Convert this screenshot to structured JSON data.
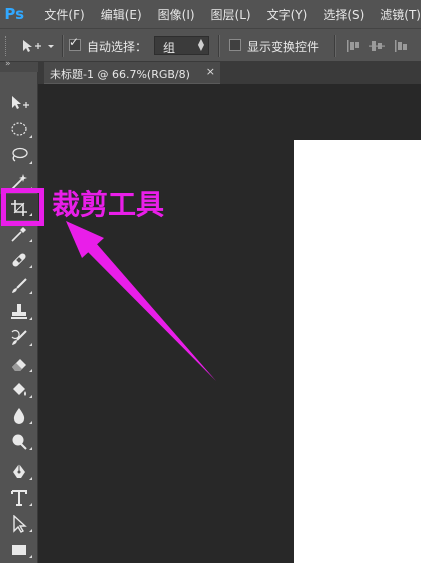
{
  "app": {
    "logo_text": "Ps"
  },
  "menu": {
    "items": [
      "文件(F)",
      "编辑(E)",
      "图像(I)",
      "图层(L)",
      "文字(Y)",
      "选择(S)",
      "滤镜(T)"
    ]
  },
  "options_bar": {
    "auto_select_label": "自动选择：",
    "auto_select_checked": true,
    "auto_select_target": "组",
    "show_transform_label": "显示变换控件",
    "show_transform_checked": false
  },
  "document": {
    "tab_title": "未标题-1 @ 66.7%(RGB/8)",
    "close_glyph": "×"
  },
  "tools": [
    {
      "name": "move-tool",
      "icon": "move-icon"
    },
    {
      "name": "marquee-tool",
      "icon": "ellipse-marquee-icon"
    },
    {
      "name": "lasso-tool",
      "icon": "lasso-icon"
    },
    {
      "name": "quick-selection-tool",
      "icon": "magic-wand-icon"
    },
    {
      "name": "crop-tool",
      "icon": "crop-icon",
      "active": true
    },
    {
      "name": "eyedropper-tool",
      "icon": "eyedropper-icon"
    },
    {
      "name": "healing-brush-tool",
      "icon": "bandage-icon"
    },
    {
      "name": "brush-tool",
      "icon": "brush-icon"
    },
    {
      "name": "clone-stamp-tool",
      "icon": "stamp-icon"
    },
    {
      "name": "history-brush-tool",
      "icon": "history-brush-icon"
    },
    {
      "name": "eraser-tool",
      "icon": "eraser-icon"
    },
    {
      "name": "paint-bucket-tool",
      "icon": "paint-bucket-icon"
    },
    {
      "name": "blur-tool",
      "icon": "droplet-icon"
    },
    {
      "name": "dodge-tool",
      "icon": "dodge-icon"
    },
    {
      "name": "pen-tool",
      "icon": "pen-icon"
    },
    {
      "name": "type-tool",
      "icon": "type-icon"
    },
    {
      "name": "path-selection-tool",
      "icon": "direct-select-icon"
    },
    {
      "name": "rectangle-tool",
      "icon": "rectangle-icon"
    }
  ],
  "annotation": {
    "label": "裁剪工具",
    "color": "#e91ee9"
  },
  "colors": {
    "panel": "#535353",
    "workspace": "#282828",
    "canvas": "#ffffff",
    "ps_blue": "#31a8ff"
  }
}
